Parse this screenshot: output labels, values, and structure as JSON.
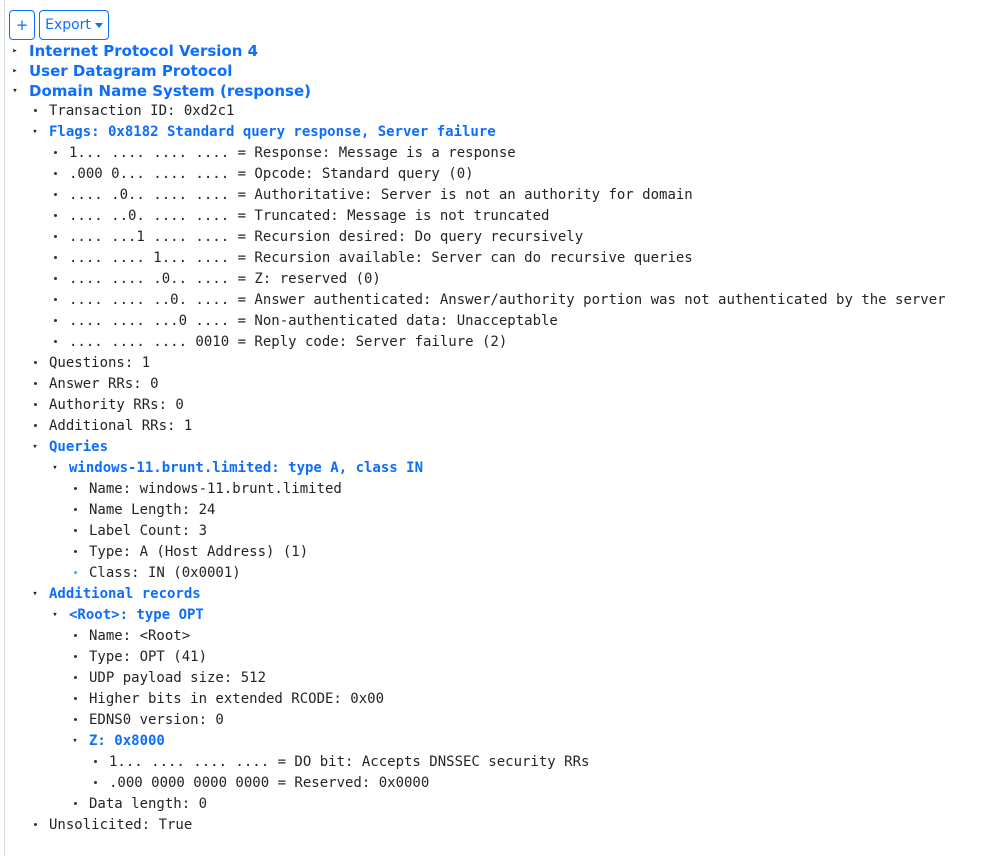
{
  "toolbar": {
    "add_label": "+",
    "export_label": "Export"
  },
  "tree": [
    {
      "label": "Internet Protocol Version 4",
      "level": 0,
      "kind": "collapsed",
      "style": "proto"
    },
    {
      "label": "User Datagram Protocol",
      "level": 0,
      "kind": "collapsed",
      "style": "proto"
    },
    {
      "label": "Domain Name System (response)",
      "level": 0,
      "kind": "expanded",
      "style": "proto"
    },
    {
      "label": "Transaction ID: 0xd2c1",
      "level": 1,
      "kind": "leaf"
    },
    {
      "label": "Flags: 0x8182 Standard query response, Server failure",
      "level": 1,
      "kind": "expanded",
      "style": "link"
    },
    {
      "label": "1... .... .... .... = Response: Message is a response",
      "level": 2,
      "kind": "leaf"
    },
    {
      "label": ".000 0... .... .... = Opcode: Standard query (0)",
      "level": 2,
      "kind": "leaf"
    },
    {
      "label": ".... .0.. .... .... = Authoritative: Server is not an authority for domain",
      "level": 2,
      "kind": "leaf"
    },
    {
      "label": ".... ..0. .... .... = Truncated: Message is not truncated",
      "level": 2,
      "kind": "leaf"
    },
    {
      "label": ".... ...1 .... .... = Recursion desired: Do query recursively",
      "level": 2,
      "kind": "leaf"
    },
    {
      "label": ".... .... 1... .... = Recursion available: Server can do recursive queries",
      "level": 2,
      "kind": "leaf"
    },
    {
      "label": ".... .... .0.. .... = Z: reserved (0)",
      "level": 2,
      "kind": "leaf"
    },
    {
      "label": ".... .... ..0. .... = Answer authenticated: Answer/authority portion was not authenticated by the server",
      "level": 2,
      "kind": "leaf"
    },
    {
      "label": ".... .... ...0 .... = Non-authenticated data: Unacceptable",
      "level": 2,
      "kind": "leaf"
    },
    {
      "label": ".... .... .... 0010 = Reply code: Server failure (2)",
      "level": 2,
      "kind": "leaf"
    },
    {
      "label": "Questions: 1",
      "level": 1,
      "kind": "leaf"
    },
    {
      "label": "Answer RRs: 0",
      "level": 1,
      "kind": "leaf"
    },
    {
      "label": "Authority RRs: 0",
      "level": 1,
      "kind": "leaf"
    },
    {
      "label": "Additional RRs: 1",
      "level": 1,
      "kind": "leaf"
    },
    {
      "label": "Queries",
      "level": 1,
      "kind": "expanded",
      "style": "link"
    },
    {
      "label": "windows-11.brunt.limited: type A, class IN",
      "level": 2,
      "kind": "expanded",
      "style": "link"
    },
    {
      "label": "Name: windows-11.brunt.limited",
      "level": 3,
      "kind": "leaf"
    },
    {
      "label": "Name Length: 24",
      "level": 3,
      "kind": "leaf"
    },
    {
      "label": "Label Count: 3",
      "level": 3,
      "kind": "leaf"
    },
    {
      "label": "Type: A (Host Address) (1)",
      "level": 3,
      "kind": "leaf"
    },
    {
      "label": "Class: IN (0x0001)",
      "level": 3,
      "kind": "leaf",
      "faint": true
    },
    {
      "label": "Additional records",
      "level": 1,
      "kind": "expanded",
      "style": "link"
    },
    {
      "label": "<Root>: type OPT",
      "level": 2,
      "kind": "expanded",
      "style": "link"
    },
    {
      "label": "Name: <Root>",
      "level": 3,
      "kind": "leaf"
    },
    {
      "label": "Type: OPT (41)",
      "level": 3,
      "kind": "leaf"
    },
    {
      "label": "UDP payload size: 512",
      "level": 3,
      "kind": "leaf"
    },
    {
      "label": "Higher bits in extended RCODE: 0x00",
      "level": 3,
      "kind": "leaf"
    },
    {
      "label": "EDNS0 version: 0",
      "level": 3,
      "kind": "leaf"
    },
    {
      "label": "Z: 0x8000",
      "level": 3,
      "kind": "expanded",
      "style": "link"
    },
    {
      "label": "1... .... .... .... = DO bit: Accepts DNSSEC security RRs",
      "level": 4,
      "kind": "leaf"
    },
    {
      "label": ".000 0000 0000 0000 = Reserved: 0x0000",
      "level": 4,
      "kind": "leaf"
    },
    {
      "label": "Data length: 0",
      "level": 3,
      "kind": "leaf"
    },
    {
      "label": "Unsolicited: True",
      "level": 1,
      "kind": "leaf"
    }
  ]
}
